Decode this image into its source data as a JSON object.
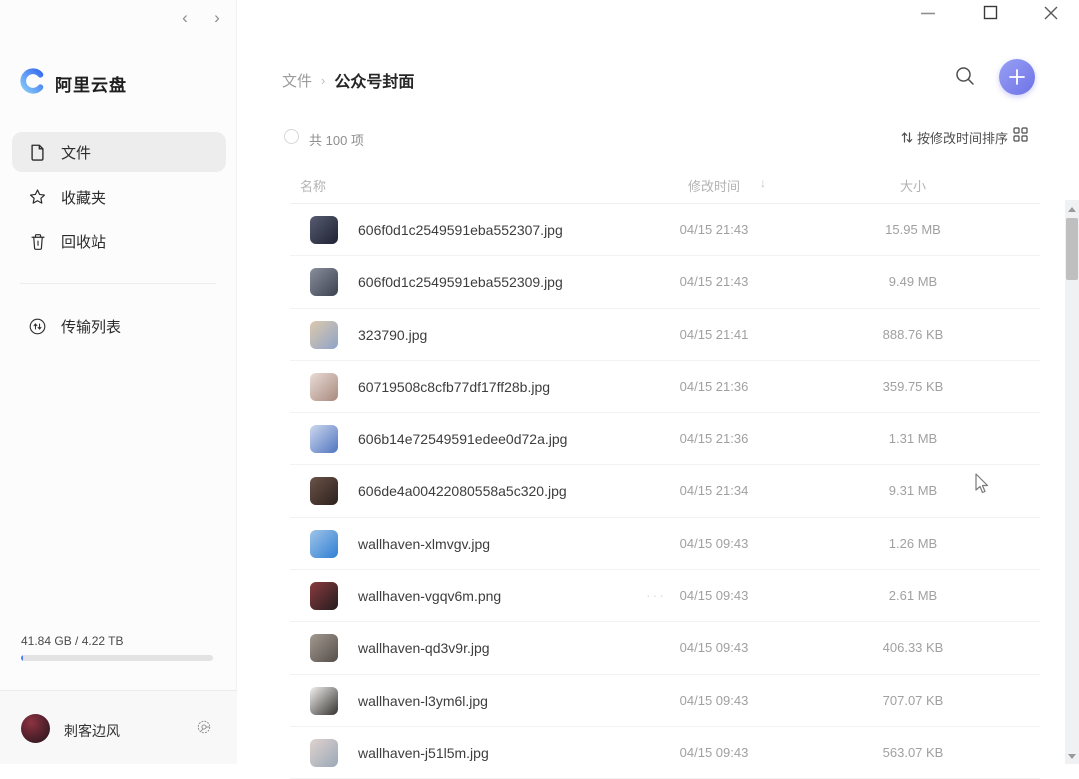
{
  "window": {
    "nav_back": "‹",
    "nav_forward": "›"
  },
  "sidebar": {
    "app_name": "阿里云盘",
    "items": [
      {
        "label": "文件",
        "icon": "file-icon",
        "selected": true
      },
      {
        "label": "收藏夹",
        "icon": "star-icon",
        "selected": false
      },
      {
        "label": "回收站",
        "icon": "trash-icon",
        "selected": false
      }
    ],
    "transfer_label": "传输列表",
    "storage": {
      "text": "41.84 GB / 4.22 TB",
      "percent": 1
    },
    "user": {
      "name": "刺客边风"
    }
  },
  "header": {
    "breadcrumb_root": "文件",
    "breadcrumb_separator": "›",
    "breadcrumb_current": "公众号封面"
  },
  "toolbar": {
    "count_label": "共 100 项",
    "sort_label": "按修改时间排序"
  },
  "table": {
    "columns": {
      "name": "名称",
      "modified": "修改时间",
      "size": "大小"
    },
    "sort_direction": "↓",
    "rows": [
      {
        "name": "606f0d1c2549591eba552307.jpg",
        "modified": "04/15 21:43",
        "size": "15.95 MB",
        "thumb": [
          "#565b70",
          "#1f2233"
        ],
        "hover_dots": false
      },
      {
        "name": "606f0d1c2549591eba552309.jpg",
        "modified": "04/15 21:43",
        "size": "9.49 MB",
        "thumb": [
          "#8a8f9e",
          "#3b414f"
        ],
        "hover_dots": false
      },
      {
        "name": "323790.jpg",
        "modified": "04/15 21:41",
        "size": "888.76 KB",
        "thumb": [
          "#dcc9ad",
          "#8fa3c8"
        ],
        "hover_dots": false
      },
      {
        "name": "60719508c8cfb77df17ff28b.jpg",
        "modified": "04/15 21:36",
        "size": "359.75 KB",
        "thumb": [
          "#e9dcd6",
          "#a8897d"
        ],
        "hover_dots": false
      },
      {
        "name": "606b14e72549591edee0d72a.jpg",
        "modified": "04/15 21:36",
        "size": "1.31 MB",
        "thumb": [
          "#cdd8ee",
          "#4f74c0"
        ],
        "hover_dots": false
      },
      {
        "name": "606de4a00422080558a5c320.jpg",
        "modified": "04/15 21:34",
        "size": "9.31 MB",
        "thumb": [
          "#6b5247",
          "#2c211d"
        ],
        "hover_dots": false
      },
      {
        "name": "wallhaven-xlmvgv.jpg",
        "modified": "04/15 09:43",
        "size": "1.26 MB",
        "thumb": [
          "#9fc4e8",
          "#2f7fd4"
        ],
        "hover_dots": false
      },
      {
        "name": "wallhaven-vgqv6m.png",
        "modified": "04/15 09:43",
        "size": "2.61 MB",
        "thumb": [
          "#8a3b3f",
          "#241c1e"
        ],
        "hover_dots": true
      },
      {
        "name": "wallhaven-qd3v9r.jpg",
        "modified": "04/15 09:43",
        "size": "406.33 KB",
        "thumb": [
          "#a39a91",
          "#554d48"
        ],
        "hover_dots": false
      },
      {
        "name": "wallhaven-l3ym6l.jpg",
        "modified": "04/15 09:43",
        "size": "707.07 KB",
        "thumb": [
          "#f1f0ee",
          "#34312e"
        ],
        "hover_dots": false
      },
      {
        "name": "wallhaven-j51l5m.jpg",
        "modified": "04/15 09:43",
        "size": "563.07 KB",
        "thumb": [
          "#dfd2ce",
          "#9aa8b8"
        ],
        "hover_dots": false
      }
    ]
  },
  "colors": {
    "accent_gradient_start": "#98a0f4",
    "accent_gradient_end": "#6d72e6",
    "progress_fill": "#4c7bf4",
    "logo_gradient_start": "#85c8f8",
    "logo_gradient_end": "#3a6ef0"
  },
  "icons": {
    "search": "magnifier",
    "add": "plus",
    "sort": "up-down-arrows",
    "view": "grid-squares",
    "file": "document",
    "favorites": "star",
    "recycle": "trash",
    "transfer": "arrows-in-circle",
    "settings": "gear",
    "minimize": "dash",
    "maximize": "square",
    "close": "x"
  }
}
